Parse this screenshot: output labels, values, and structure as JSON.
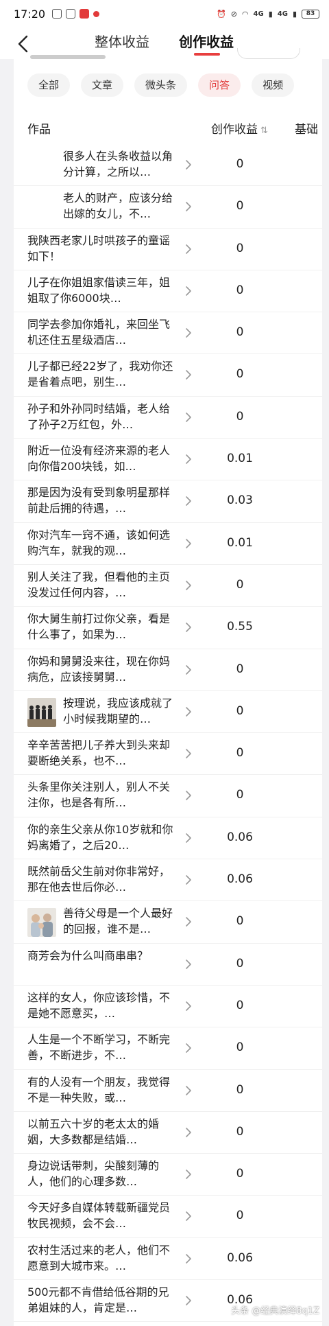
{
  "status": {
    "time": "17:20",
    "net1": "4G",
    "net2": "4G",
    "battery": "83"
  },
  "nav": {
    "tab_overall": "整体收益",
    "tab_creation": "创作收益"
  },
  "filters": [
    {
      "label": "全部",
      "active": false
    },
    {
      "label": "文章",
      "active": false
    },
    {
      "label": "微头条",
      "active": false
    },
    {
      "label": "问答",
      "active": true
    },
    {
      "label": "视频",
      "active": false
    }
  ],
  "table": {
    "col_works": "作品",
    "col_earnings": "创作收益",
    "sort_icon": "⇅",
    "col_base": "基础"
  },
  "rows": [
    {
      "title": "很多人在头条收益以角分计算，之所以…",
      "value": "0",
      "thumb": "blank"
    },
    {
      "title": "老人的财产，应该分给出嫁的女儿，不…",
      "value": "0",
      "thumb": "blank"
    },
    {
      "title": "我陕西老家儿时哄孩子的童谣如下！",
      "value": "0"
    },
    {
      "title": "儿子在你姐姐家借读三年，姐姐取了你6000块…",
      "value": "0"
    },
    {
      "title": "同学去参加你婚礼，来回坐飞机还住五星级酒店…",
      "value": "0"
    },
    {
      "title": "儿子都已经22岁了，我劝你还是省着点吧，别生…",
      "value": "0"
    },
    {
      "title": "孙子和外孙同时结婚，老人给了孙子2万红包，外…",
      "value": "0"
    },
    {
      "title": "附近一位没有经济来源的老人向你借200块钱，如…",
      "value": "0.01"
    },
    {
      "title": "那是因为没有受到象明星那样前赴后拥的待遇，…",
      "value": "0.03"
    },
    {
      "title": "你对汽车一窍不通，该如何选购汽车，就我的观…",
      "value": "0.01"
    },
    {
      "title": "别人关注了我，但看他的主页没发过任何内容，…",
      "value": "0"
    },
    {
      "title": "你大舅生前打过你父亲，看是什么事了，如果为…",
      "value": "0.55"
    },
    {
      "title": "你妈和舅舅没来往，现在你妈病危，应该接舅舅…",
      "value": "0"
    },
    {
      "title": "按理说，我应该成就了小时候我期望的…",
      "value": "0",
      "thumb": "group"
    },
    {
      "title": "辛辛苦苦把儿子养大到头来却要断绝关系，也不…",
      "value": "0"
    },
    {
      "title": "头条里你关注别人，别人不关注你，也是各有所…",
      "value": "0"
    },
    {
      "title": "你的亲生父亲从你10岁就和你妈离婚了，之后20…",
      "value": "0.06"
    },
    {
      "title": "既然前岳父生前对你非常好，那在他去世后你必…",
      "value": "0.06"
    },
    {
      "title": "善待父母是一个人最好的回报，谁不是…",
      "value": "0",
      "thumb": "family"
    },
    {
      "title": "商芳会为什么叫商串串？",
      "value": "0"
    },
    {
      "title": "这样的女人，你应该珍惜，不是她不愿意买，…",
      "value": "0"
    },
    {
      "title": "人生是一个不断学习，不断完善，不断进步，不…",
      "value": "0"
    },
    {
      "title": "有的人没有一个朋友，我觉得不是一种失败，或…",
      "value": "0"
    },
    {
      "title": "以前五六十岁的老太太的婚姻，大多数都是结婚…",
      "value": "0"
    },
    {
      "title": "身边说话带刺，尖酸刻薄的人，他们的心理多数…",
      "value": "0"
    },
    {
      "title": "今天好多自媒体转载新疆党员牧民视频，会不会…",
      "value": "0"
    },
    {
      "title": "农村生活过来的老人，他们不愿意到大城市来。…",
      "value": "0.06"
    },
    {
      "title": "500元都不肯借给低谷期的兄弟姐妹的人，肯定是…",
      "value": "0.06"
    }
  ],
  "watermark": "头条 @经典演绎8q1Z",
  "colors": {
    "accent": "#e83e3e",
    "background": "#f2f2f4"
  },
  "icons": [
    "back-arrow-icon",
    "chevron-right-icon",
    "sort-icon"
  ]
}
